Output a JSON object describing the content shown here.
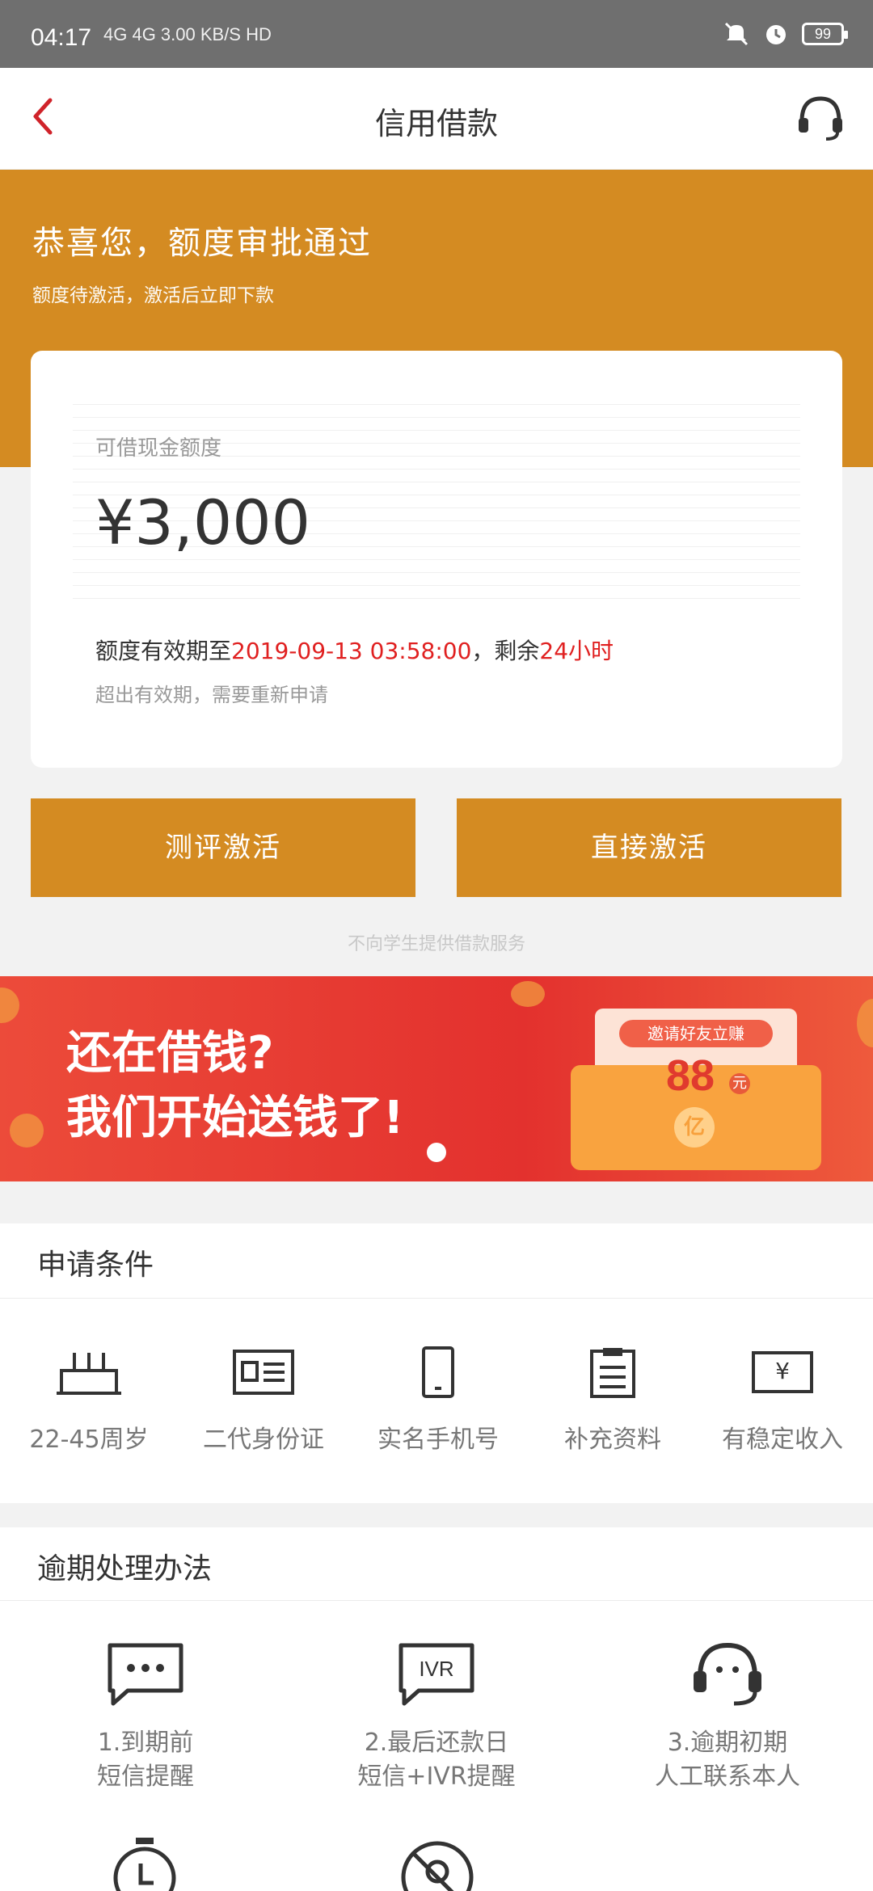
{
  "status_bar": {
    "time": "04:17",
    "network": "4G 4G 3.00 KB/S HD",
    "battery": "99"
  },
  "nav": {
    "title": "信用借款"
  },
  "hero": {
    "title": "恭喜您，额度审批通过",
    "subtitle": "额度待激活，激活后立即下款"
  },
  "card": {
    "label": "可借现金额度",
    "amount": "¥3,000",
    "validity_prefix": "额度有效期至",
    "validity_date": "2019-09-13 03:58:00",
    "validity_mid": "，剩余",
    "validity_remaining": "24小时",
    "note": "超出有效期，需要重新申请"
  },
  "buttons": {
    "evaluate_activate": "测评激活",
    "direct_activate": "直接激活"
  },
  "student_note": "不向学生提供借款服务",
  "banner": {
    "line1": "还在借钱?",
    "line2": "我们开始送钱了!",
    "invite_label": "邀请好友立赚",
    "invite_amount": "88",
    "invite_unit": "元",
    "seal_text": "亿"
  },
  "conditions": {
    "title": "申请条件",
    "items": [
      {
        "label": "22-45周岁",
        "icon": "birthday-cake-icon"
      },
      {
        "label": "二代身份证",
        "icon": "id-card-icon"
      },
      {
        "label": "实名手机号",
        "icon": "phone-icon"
      },
      {
        "label": "补充资料",
        "icon": "clipboard-icon"
      },
      {
        "label": "有稳定收入",
        "icon": "yen-bill-icon"
      }
    ]
  },
  "overdue": {
    "title": "逾期处理办法",
    "items": [
      {
        "line1": "1.到期前",
        "line2": "短信提醒",
        "icon": "sms-icon"
      },
      {
        "line1": "2.最后还款日",
        "line2": "短信+IVR提醒",
        "icon": "ivr-icon"
      },
      {
        "line1": "3.逾期初期",
        "line2": "人工联系本人",
        "icon": "headset-icon"
      }
    ],
    "icon_ivr_text": "IVR"
  },
  "colors": {
    "brand": "#d48b22",
    "alert_red": "#e02020",
    "banner_red": "#e3312e"
  }
}
